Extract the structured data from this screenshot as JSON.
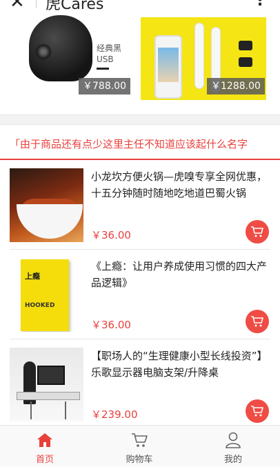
{
  "window": {
    "title": "虎Cares",
    "close_icon": "close-icon",
    "more_icon": "more-icon"
  },
  "banner": {
    "items": [
      {
        "model_line1": "经典黑",
        "model_line2": "USB",
        "price": "￥788.00"
      },
      {
        "price": "￥1288.00"
      }
    ]
  },
  "section": {
    "title": "「由于商品还有点少这里主任不知道应该起什么名字"
  },
  "products": [
    {
      "name": "小龙坎方便火锅—虎嗅专享全网优惠，十五分钟随时随地吃地道巴蜀火锅",
      "price": "￥36.00"
    },
    {
      "name": "《上瘾：让用户养成使用习惯的四大产品逻辑》",
      "price": "￥36.00",
      "book_title": "上瘾",
      "book_subtitle": "HOOKED"
    },
    {
      "name": "【职场人的“生理健康小型长线投资”】乐歌显示器电脑支架/升降桌",
      "price": "￥239.00"
    }
  ],
  "tabbar": {
    "tabs": [
      {
        "label": "首页",
        "icon": "home-icon",
        "active": true
      },
      {
        "label": "购物车",
        "icon": "cart-icon",
        "active": false
      },
      {
        "label": "我的",
        "icon": "user-icon",
        "active": false
      }
    ]
  },
  "colors": {
    "accent": "#e8413c",
    "cart_button": "#ee4c44"
  }
}
